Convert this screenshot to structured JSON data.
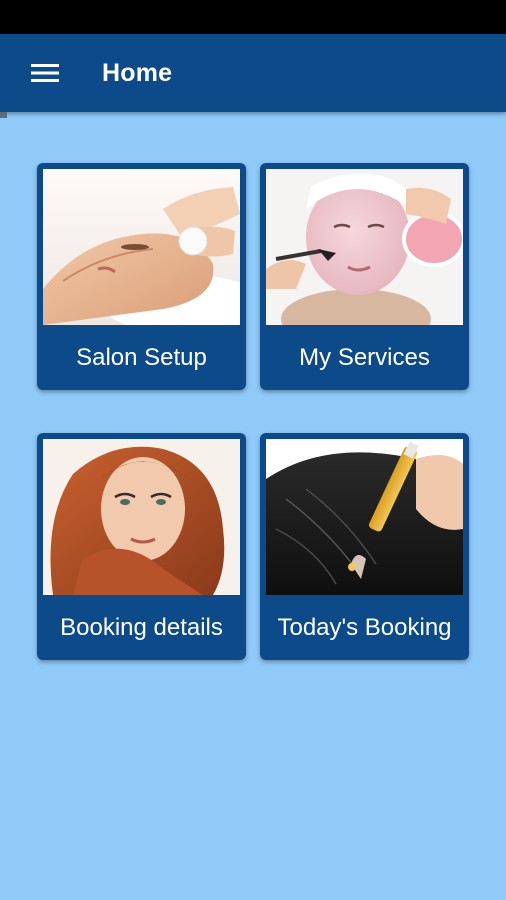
{
  "app_bar": {
    "title": "Home",
    "menu_icon": "hamburger-menu-icon"
  },
  "theme": {
    "background": "#90caf9",
    "primary": "#0d4a8a",
    "status_bar": "#000000",
    "text_on_primary": "#ffffff"
  },
  "tiles": [
    {
      "label": "Salon Setup"
    },
    {
      "label": "My Services"
    },
    {
      "label": "Booking details"
    },
    {
      "label": "Today's Booking"
    }
  ]
}
